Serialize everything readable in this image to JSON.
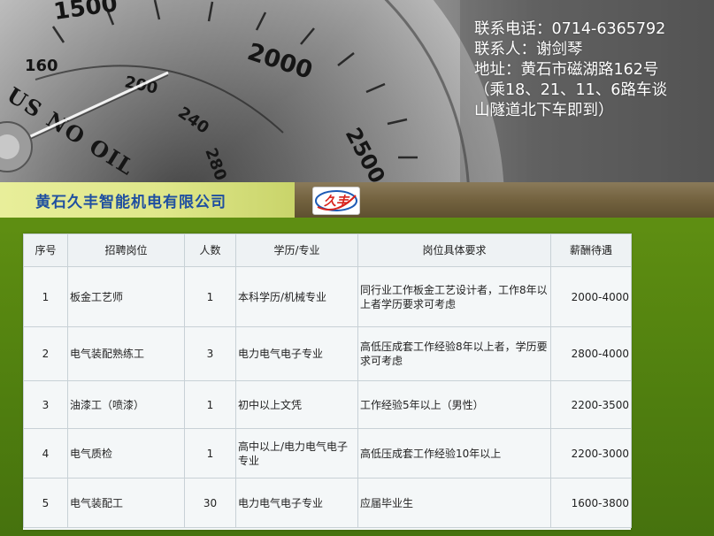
{
  "contact": {
    "phone_line": "联系电话：0714-6365792",
    "person_line": "联系人：谢剑琴",
    "address_line1": "地址：黄石市磁湖路162号",
    "address_line2": "（乘18、21、11、6路车谈",
    "address_line3": "山隧道北下车即到）"
  },
  "gauge_labels": {
    "t1500": "1500",
    "t160": "160",
    "t2000": "2000",
    "t200": "200",
    "t240": "240",
    "t2500": "2500",
    "t280": "280",
    "brand": "US NO OIL"
  },
  "company": {
    "name": "黄石久丰智能机电有限公司",
    "logo_text": "久丰"
  },
  "colors": {
    "company_name": "#1f4fa0",
    "logo_red": "#d8231c",
    "logo_blue": "#1e5bb5",
    "background_green": "#5f8f12"
  },
  "table": {
    "headers": [
      "序号",
      "招聘岗位",
      "人数",
      "学历/专业",
      "岗位具体要求",
      "薪酬待遇"
    ],
    "rows": [
      [
        "1",
        "板金工艺师",
        "1",
        "本科学历/机械专业",
        "同行业工作板金工艺设计者，工作8年以上者学历要求可考虑",
        "2000-4000"
      ],
      [
        "2",
        "电气装配熟练工",
        "3",
        "电力电气电子专业",
        "高低压成套工作经验8年以上者，学历要求可考虑",
        "2800-4000"
      ],
      [
        "3",
        "油漆工（喷漆）",
        "1",
        "初中以上文凭",
        "工作经验5年以上（男性）",
        "2200-3500"
      ],
      [
        "4",
        "电气质检",
        "1",
        "高中以上/电力电气电子专业",
        "高低压成套工作经验10年以上",
        "2200-3000"
      ],
      [
        "5",
        "电气装配工",
        "30",
        "电力电气电子专业",
        "应届毕业生",
        "1600-3800"
      ]
    ]
  }
}
